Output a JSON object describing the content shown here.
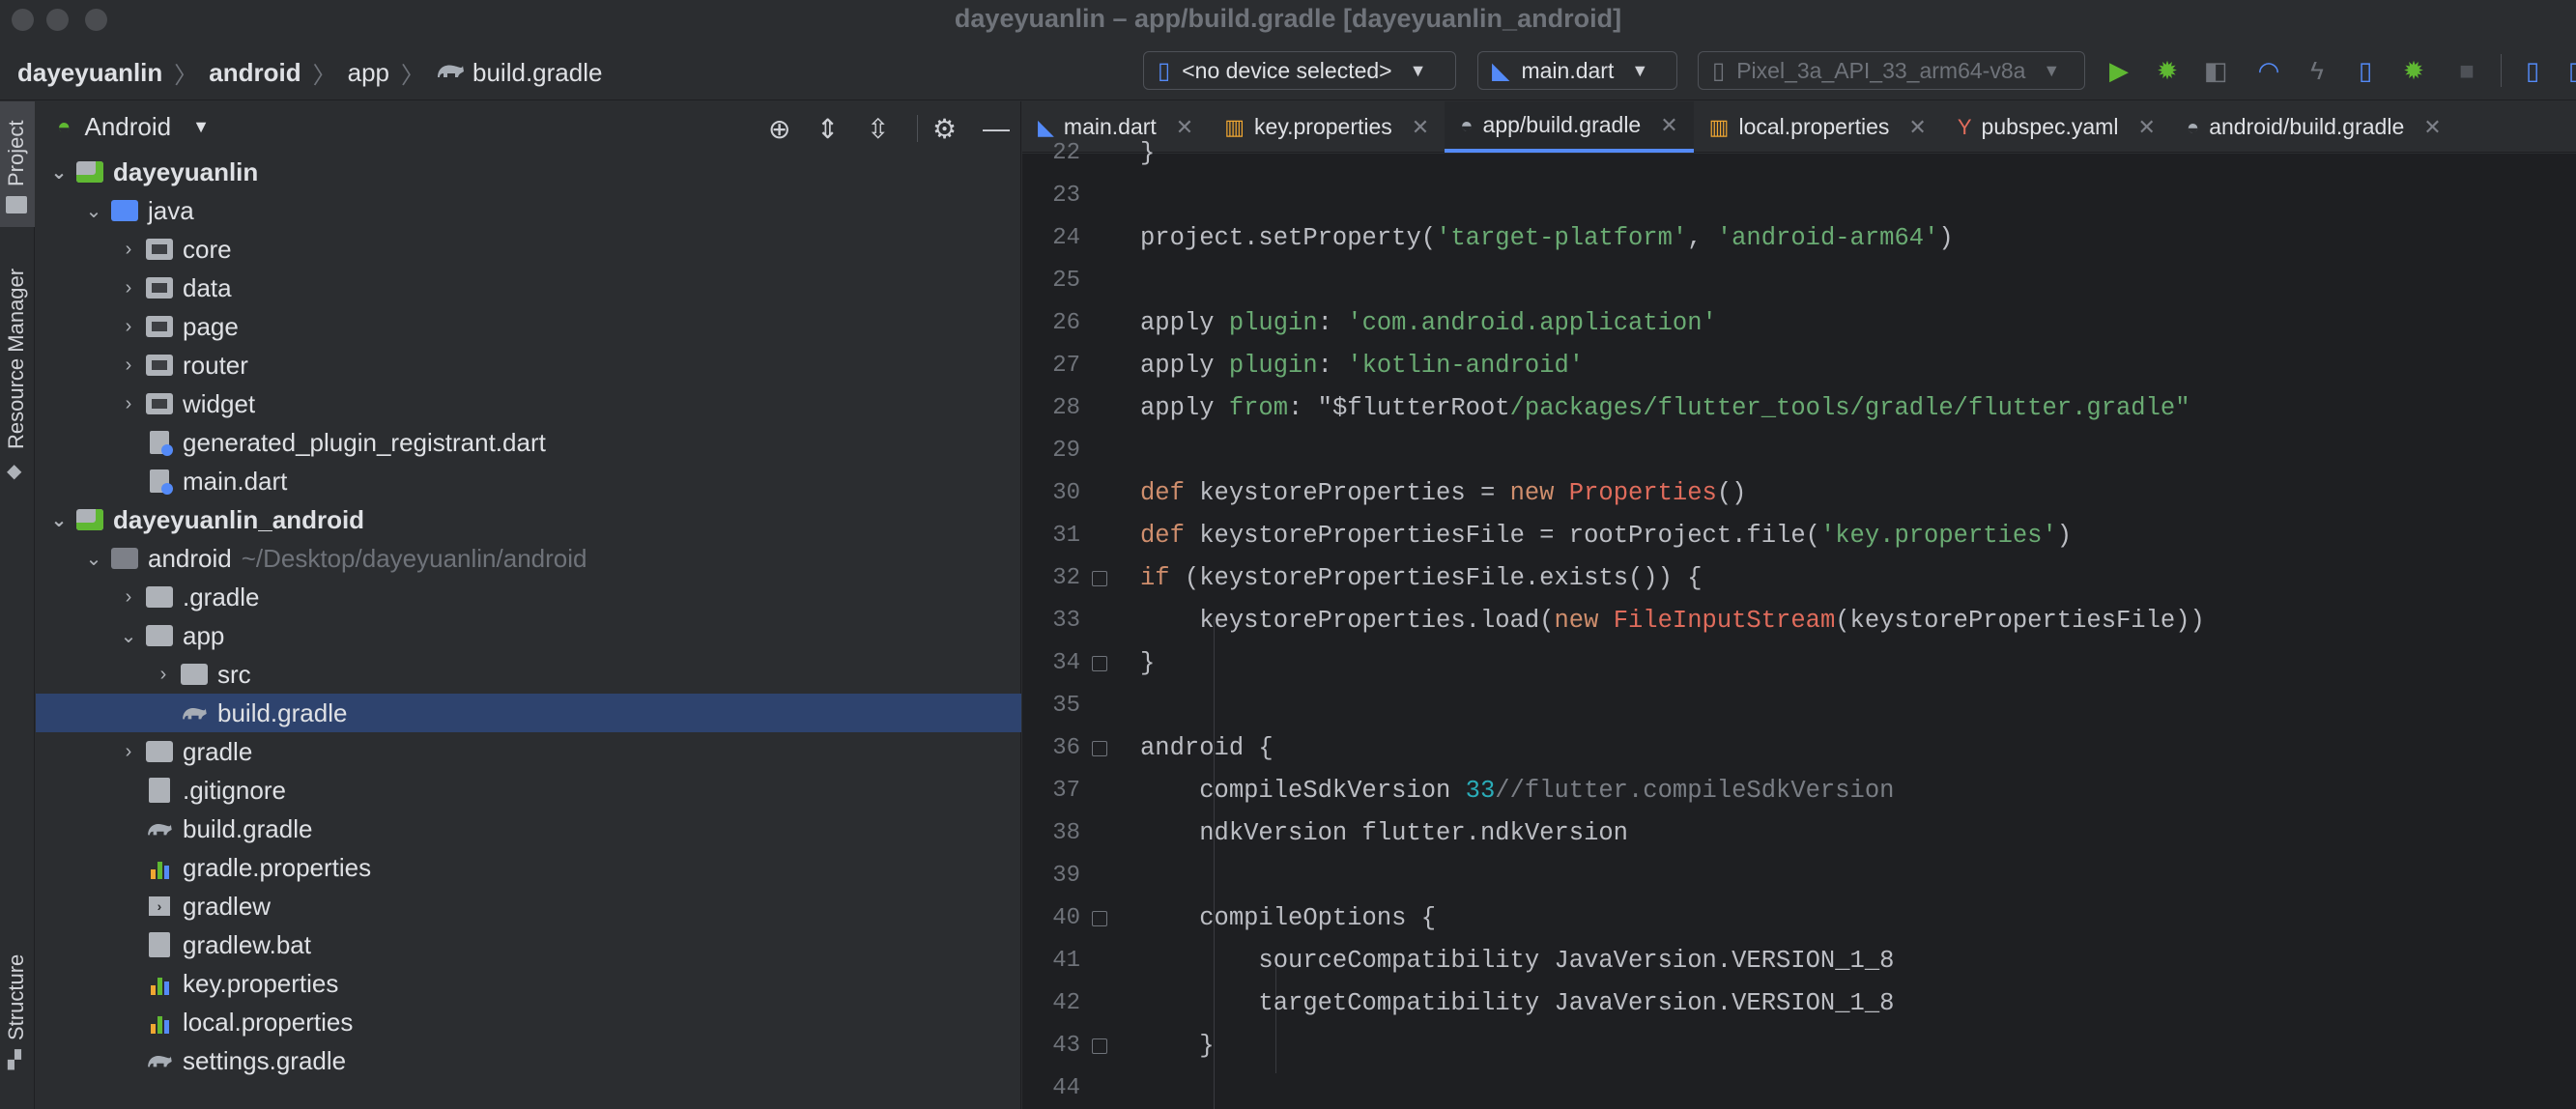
{
  "window": {
    "title": "dayeyuanlin – app/build.gradle [dayeyuanlin_android]"
  },
  "breadcrumb": [
    "dayeyuanlin",
    "android",
    "app",
    "build.gradle"
  ],
  "toolbar": {
    "device_selector": "<no device selected>",
    "run_config": "main.dart",
    "emulator": "Pixel_3a_API_33_arm64-v8a"
  },
  "stripe": {
    "project": "Project",
    "resource_manager": "Resource Manager",
    "structure": "Structure"
  },
  "project_panel": {
    "view_selector": "Android"
  },
  "tree": [
    {
      "label": "dayeyuanlin",
      "indent": 0,
      "arrow": "open",
      "icon": "module",
      "bold": true
    },
    {
      "label": "java",
      "indent": 1,
      "arrow": "open",
      "icon": "folder-blue"
    },
    {
      "label": "core",
      "indent": 2,
      "arrow": "closed",
      "icon": "folder-pkg"
    },
    {
      "label": "data",
      "indent": 2,
      "arrow": "closed",
      "icon": "folder-pkg"
    },
    {
      "label": "page",
      "indent": 2,
      "arrow": "closed",
      "icon": "folder-pkg"
    },
    {
      "label": "router",
      "indent": 2,
      "arrow": "closed",
      "icon": "folder-pkg"
    },
    {
      "label": "widget",
      "indent": 2,
      "arrow": "closed",
      "icon": "folder-pkg"
    },
    {
      "label": "generated_plugin_registrant.dart",
      "indent": 2,
      "arrow": "none",
      "icon": "dart-file"
    },
    {
      "label": "main.dart",
      "indent": 2,
      "arrow": "none",
      "icon": "dart-file"
    },
    {
      "label": "dayeyuanlin_android",
      "indent": 0,
      "arrow": "open",
      "icon": "module",
      "bold": true
    },
    {
      "label": "android",
      "suffix": "~/Desktop/dayeyuanlin/android",
      "indent": 1,
      "arrow": "open",
      "icon": "folder-dark"
    },
    {
      "label": ".gradle",
      "indent": 2,
      "arrow": "closed",
      "icon": "folder"
    },
    {
      "label": "app",
      "indent": 2,
      "arrow": "open",
      "icon": "folder"
    },
    {
      "label": "src",
      "indent": 3,
      "arrow": "closed",
      "icon": "folder"
    },
    {
      "label": "build.gradle",
      "indent": 3,
      "arrow": "none",
      "icon": "gradle",
      "selected": true
    },
    {
      "label": "gradle",
      "indent": 2,
      "arrow": "closed",
      "icon": "folder"
    },
    {
      "label": ".gitignore",
      "indent": 2,
      "arrow": "none",
      "icon": "file"
    },
    {
      "label": "build.gradle",
      "indent": 2,
      "arrow": "none",
      "icon": "gradle"
    },
    {
      "label": "gradle.properties",
      "indent": 2,
      "arrow": "none",
      "icon": "properties"
    },
    {
      "label": "gradlew",
      "indent": 2,
      "arrow": "none",
      "icon": "terminal"
    },
    {
      "label": "gradlew.bat",
      "indent": 2,
      "arrow": "none",
      "icon": "file"
    },
    {
      "label": "key.properties",
      "indent": 2,
      "arrow": "none",
      "icon": "properties"
    },
    {
      "label": "local.properties",
      "indent": 2,
      "arrow": "none",
      "icon": "properties"
    },
    {
      "label": "settings.gradle",
      "indent": 2,
      "arrow": "none",
      "icon": "gradle"
    }
  ],
  "tabs": [
    {
      "label": "main.dart",
      "icon": "dart",
      "active": false
    },
    {
      "label": "key.properties",
      "icon": "properties",
      "active": false
    },
    {
      "label": "app/build.gradle",
      "icon": "gradle",
      "active": true
    },
    {
      "label": "local.properties",
      "icon": "properties",
      "active": false
    },
    {
      "label": "pubspec.yaml",
      "icon": "yaml",
      "active": false
    },
    {
      "label": "android/build.gradle",
      "icon": "gradle",
      "active": false
    }
  ],
  "code": [
    {
      "n": "22",
      "tokens": [
        [
          "}",
          "plain"
        ]
      ]
    },
    {
      "n": "23",
      "tokens": []
    },
    {
      "n": "24",
      "tokens": [
        [
          "project.setProperty(",
          "plain"
        ],
        [
          "'target-platform'",
          "str"
        ],
        [
          ", ",
          "plain"
        ],
        [
          "'android-arm64'",
          "str"
        ],
        [
          ")",
          "plain"
        ]
      ]
    },
    {
      "n": "25",
      "tokens": []
    },
    {
      "n": "26",
      "tokens": [
        [
          "apply ",
          "plain"
        ],
        [
          "plugin",
          "str"
        ],
        [
          ": ",
          "plain"
        ],
        [
          "'com.android.application'",
          "str"
        ]
      ]
    },
    {
      "n": "27",
      "tokens": [
        [
          "apply ",
          "plain"
        ],
        [
          "plugin",
          "str"
        ],
        [
          ": ",
          "plain"
        ],
        [
          "'kotlin-android'",
          "str"
        ]
      ]
    },
    {
      "n": "28",
      "tokens": [
        [
          "apply ",
          "plain"
        ],
        [
          "from",
          "str"
        ],
        [
          ": ",
          "plain"
        ],
        [
          "\"$flutterRoot",
          "plain"
        ],
        [
          "/packages/flutter_tools/gradle/flutter.gradle\"",
          "str"
        ]
      ]
    },
    {
      "n": "29",
      "tokens": []
    },
    {
      "n": "30",
      "tokens": [
        [
          "def ",
          "kw"
        ],
        [
          "keystoreProperties = ",
          "plain"
        ],
        [
          "new ",
          "kw"
        ],
        [
          "Properties",
          "cls"
        ],
        [
          "()",
          "plain"
        ]
      ]
    },
    {
      "n": "31",
      "tokens": [
        [
          "def ",
          "kw"
        ],
        [
          "keystorePropertiesFile = rootProject.file(",
          "plain"
        ],
        [
          "'key.properties'",
          "str"
        ],
        [
          ")",
          "plain"
        ]
      ]
    },
    {
      "n": "32",
      "tokens": [
        [
          "if ",
          "kw"
        ],
        [
          "(keystorePropertiesFile.exists()) {",
          "plain"
        ]
      ],
      "fold": true
    },
    {
      "n": "33",
      "tokens": [
        [
          "    keystoreProperties.load(",
          "plain"
        ],
        [
          "new ",
          "kw"
        ],
        [
          "FileInputStream",
          "cls"
        ],
        [
          "(keystorePropertiesFile))",
          "plain"
        ]
      ]
    },
    {
      "n": "34",
      "tokens": [
        [
          "}",
          "plain"
        ]
      ],
      "fold": true
    },
    {
      "n": "35",
      "tokens": []
    },
    {
      "n": "36",
      "tokens": [
        [
          "android {",
          "plain"
        ]
      ],
      "fold": true
    },
    {
      "n": "37",
      "tokens": [
        [
          "    compileSdkVersion ",
          "plain"
        ],
        [
          "33",
          "num"
        ],
        [
          "//flutter.compileSdkVersion",
          "cmt"
        ]
      ]
    },
    {
      "n": "38",
      "tokens": [
        [
          "    ndkVersion flutter.ndkVersion",
          "plain"
        ]
      ]
    },
    {
      "n": "39",
      "tokens": []
    },
    {
      "n": "40",
      "tokens": [
        [
          "    compileOptions {",
          "plain"
        ]
      ],
      "fold": true
    },
    {
      "n": "41",
      "tokens": [
        [
          "        sourceCompatibility JavaVersion.VERSION_1_8",
          "plain"
        ]
      ]
    },
    {
      "n": "42",
      "tokens": [
        [
          "        targetCompatibility JavaVersion.VERSION_1_8",
          "plain"
        ]
      ]
    },
    {
      "n": "43",
      "tokens": [
        [
          "    }",
          "plain"
        ]
      ],
      "fold": true
    },
    {
      "n": "44",
      "tokens": []
    }
  ],
  "colors": {
    "selection": "#2e436e",
    "accent": "#548af7",
    "keyword": "#cf8e6d",
    "string": "#6aab73",
    "number": "#2aacb8",
    "class": "#e06c5c",
    "run": "#5fb832"
  }
}
